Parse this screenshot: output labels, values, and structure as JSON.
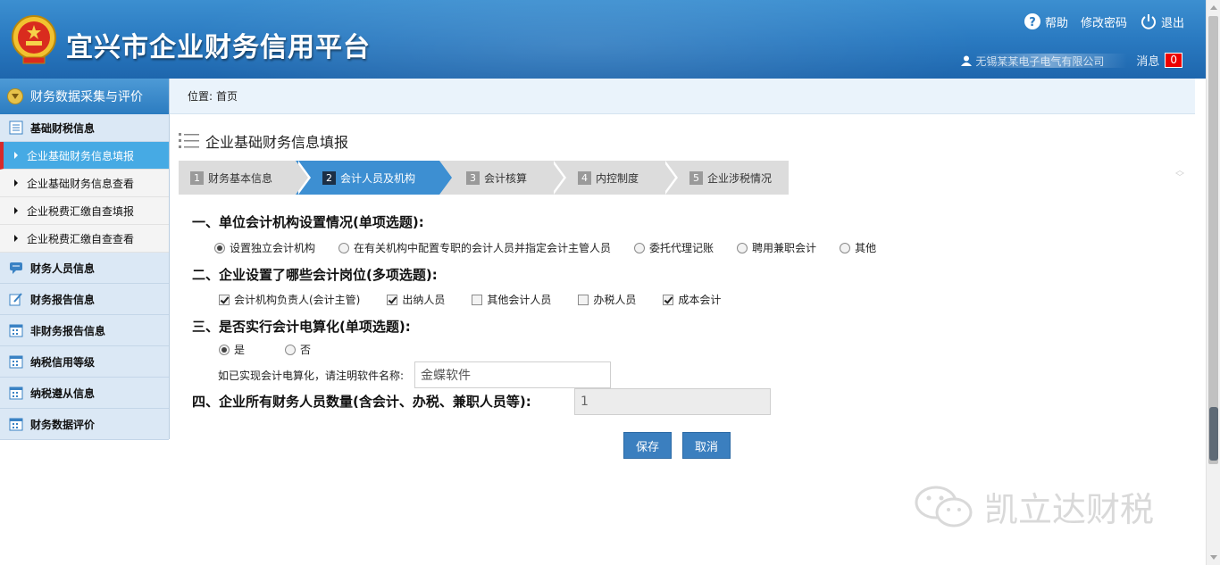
{
  "header": {
    "site_title": "宜兴市企业财务信用平台",
    "links": {
      "help": "帮助",
      "change_password": "修改密码",
      "logout": "退出"
    },
    "user_name": "无锡某某电子电气有限公司",
    "messages_label": "消息",
    "messages_count": "0"
  },
  "sidebar": {
    "header": "财务数据采集与评价",
    "groups": [
      {
        "label": "基础财税信息"
      },
      {
        "label": "财务人员信息"
      },
      {
        "label": "财务报告信息"
      },
      {
        "label": "非财务报告信息"
      },
      {
        "label": "纳税信用等级"
      },
      {
        "label": "纳税遵从信息"
      },
      {
        "label": "财务数据评价"
      }
    ],
    "items": [
      {
        "label": "企业基础财务信息填报",
        "active": true
      },
      {
        "label": "企业基础财务信息查看"
      },
      {
        "label": "企业税费汇缴自查填报"
      },
      {
        "label": "企业税费汇缴自查查看"
      }
    ]
  },
  "breadcrumb": {
    "label": "位置:",
    "current": "首页"
  },
  "main": {
    "section_title": "企业基础财务信息填报",
    "steps": [
      {
        "num": "1",
        "label": "财务基本信息"
      },
      {
        "num": "2",
        "label": "会计人员及机构",
        "active": true
      },
      {
        "num": "3",
        "label": "会计核算"
      },
      {
        "num": "4",
        "label": "内控制度"
      },
      {
        "num": "5",
        "label": "企业涉税情况"
      }
    ],
    "q1": {
      "title": "一、单位会计机构设置情况(单项选题):",
      "options": [
        "设置独立会计机构",
        "在有关机构中配置专职的会计人员并指定会计主管人员",
        "委托代理记账",
        "聘用兼职会计",
        "其他"
      ],
      "selected": "设置独立会计机构"
    },
    "q2": {
      "title": "二、企业设置了哪些会计岗位(多项选题):",
      "options": [
        {
          "label": "会计机构负责人(会计主管)",
          "checked": true
        },
        {
          "label": "出纳人员",
          "checked": true
        },
        {
          "label": "其他会计人员",
          "checked": false
        },
        {
          "label": "办税人员",
          "checked": false
        },
        {
          "label": "成本会计",
          "checked": true
        }
      ]
    },
    "q3": {
      "title": "三、是否实行会计电算化(单项选题):",
      "options": [
        "是",
        "否"
      ],
      "selected": "是",
      "software_label": "如已实现会计电算化，请注明软件名称:",
      "software_value": "金蝶软件"
    },
    "q4": {
      "title": "四、企业所有财务人员数量(含会计、办税、兼职人员等):",
      "value": "1"
    },
    "buttons": {
      "save": "保存",
      "cancel": "取消"
    }
  },
  "watermark": {
    "text": "凯立达财税"
  },
  "colors": {
    "header_blue": "#2a7ac1",
    "active_step": "#3d8fd2",
    "active_nav": "#46aae4",
    "badge_red": "#e00000",
    "button_blue": "#3b7fbf"
  }
}
